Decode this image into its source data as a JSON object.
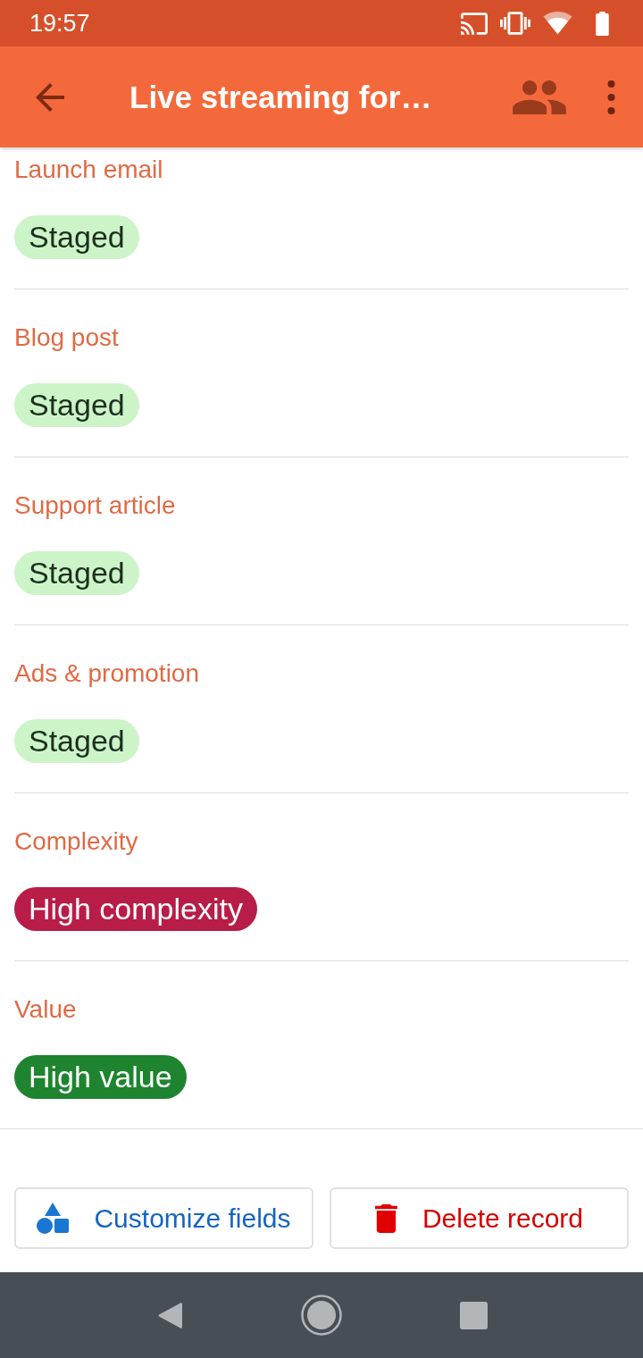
{
  "status_bar": {
    "time": "19:57"
  },
  "app_bar": {
    "title": "Live streaming for…"
  },
  "fields": [
    {
      "label": "Launch email",
      "chip": {
        "text": "Staged",
        "color": "#ccf4c8"
      }
    },
    {
      "label": "Blog post",
      "chip": {
        "text": "Staged",
        "color": "#ccf4c8"
      }
    },
    {
      "label": "Support article",
      "chip": {
        "text": "Staged",
        "color": "#ccf4c8"
      }
    },
    {
      "label": "Ads & promotion",
      "chip": {
        "text": "Staged",
        "color": "#ccf4c8"
      }
    },
    {
      "label": "Complexity",
      "chip": {
        "text": "High complexity",
        "color": "#b81d47"
      }
    },
    {
      "label": "Value",
      "chip": {
        "text": "High value",
        "color": "#1e842f"
      }
    }
  ],
  "actions": [
    {
      "label": "Customize fields",
      "kind": "customize"
    },
    {
      "label": "Delete record",
      "kind": "delete"
    }
  ]
}
